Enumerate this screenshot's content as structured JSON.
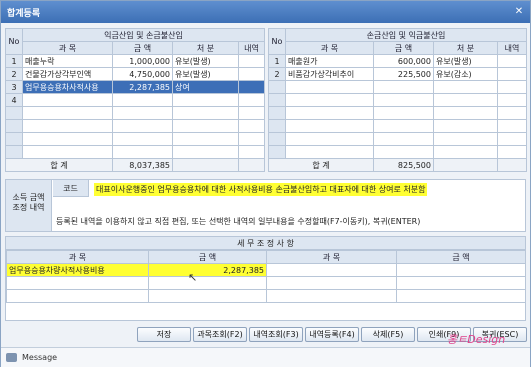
{
  "window": {
    "title": "합계등록",
    "close": "✕"
  },
  "left_table": {
    "title": "익금산입 및 손금불산입",
    "headers": {
      "no": "No",
      "item": "과  목",
      "amount": "금  액",
      "disposal": "처  분",
      "detail": "내역"
    },
    "rows": [
      {
        "no": "1",
        "item": "매출누락",
        "amount": "1,000,000",
        "disposal": "유보(발생)"
      },
      {
        "no": "2",
        "item": "건물감가상각부인액",
        "amount": "4,750,000",
        "disposal": "유보(발생)"
      },
      {
        "no": "3",
        "item": "업무용승용차사적사용",
        "amount": "2,287,385",
        "disposal": "상여"
      },
      {
        "no": "4",
        "item": "",
        "amount": "",
        "disposal": ""
      }
    ],
    "total_label": "합  계",
    "total": "8,037,385"
  },
  "right_table": {
    "title": "손금산입 및 익금불산입",
    "headers": {
      "no": "No",
      "item": "과  목",
      "amount": "금  액",
      "disposal": "처  분",
      "detail": "내역"
    },
    "rows": [
      {
        "no": "1",
        "item": "매출원가",
        "amount": "600,000",
        "disposal": "유보(발생)"
      },
      {
        "no": "2",
        "item": "비품감가상각비추이",
        "amount": "225,500",
        "disposal": "유보(감소)"
      }
    ],
    "total_label": "합  계",
    "total": "825,500"
  },
  "memo": {
    "side_label_1": "소득 금액",
    "side_label_2": "조정 내역",
    "code_label": "코드",
    "code_text": "대표이사운행중인 업무용승용차에 대한 사적사용비용 손금불산입하고 대표자에 대한 상여로 처분함",
    "hint": "등록된 내역을 이용하지 않고 직접 편집, 또는 선택한 내역의 일부내용을 수정할때(F7-이동키), 복귀(ENTER)"
  },
  "tax_adjustment": {
    "title": "세 무 조 정 사 항",
    "headers": {
      "item1": "과  목",
      "amount1": "금  액",
      "item2": "과  목",
      "amount2": "금  액"
    },
    "row": {
      "item1": "업무용승용차량사적사용비용",
      "amount1": "2,287,385",
      "item2": "",
      "amount2": ""
    }
  },
  "buttons": {
    "save": "저장",
    "account_search": "과목조회(F2)",
    "detail_search": "내역조회(F3)",
    "detail_register": "내역등록(F4)",
    "delete": "삭제(F5)",
    "print": "인쇄(F9)",
    "back": "복귀(ESC)"
  },
  "status": {
    "message": "Message"
  },
  "watermark": "홍ㅌDesign",
  "colors": {
    "selection": "#3d6fb7",
    "highlight": "#ffff33",
    "titlebar": "#3c6fb5"
  }
}
